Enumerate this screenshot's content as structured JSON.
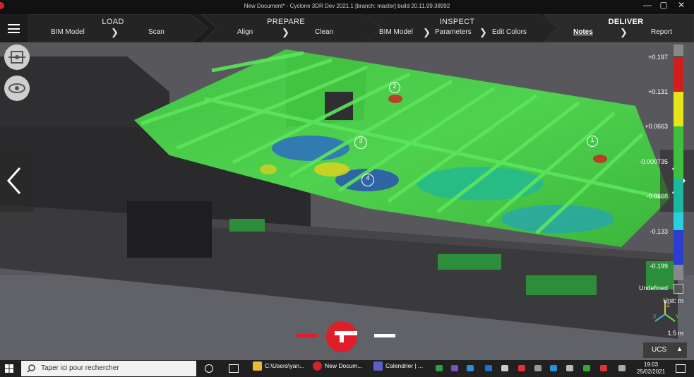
{
  "window": {
    "title": "New Document* - Cyclone 3DR Dev 2021.1 [branch: master] build 20.11.99.38992",
    "minimize": "—",
    "maximize": "▢",
    "close": "✕"
  },
  "ribbon": {
    "stages": [
      {
        "name": "LOAD",
        "steps": [
          "BIM Model",
          "Scan"
        ]
      },
      {
        "name": "PREPARE",
        "steps": [
          "Align",
          "Clean"
        ]
      },
      {
        "name": "INSPECT",
        "steps": [
          "BIM Model",
          "Parameters",
          "Edit Colors"
        ]
      },
      {
        "name": "DELIVER",
        "steps": [
          "Notes",
          "Report"
        ]
      }
    ],
    "chevron": "❯"
  },
  "viewport": {
    "markers": [
      "1",
      "2",
      "3",
      "4"
    ]
  },
  "legend": {
    "labels": [
      "+0.197",
      "+0.131",
      "+0.0663",
      "-0.000735",
      "-0.0668",
      "-0.133",
      "-0.199"
    ],
    "undefined_label": "Undefined",
    "unit": "Unit: m",
    "scale": "1.5 m",
    "axes": [
      "Z",
      "X",
      "Y"
    ],
    "colors": [
      "#d31e1e",
      "#e5e51a",
      "#3fbf3f",
      "#1bb7a0",
      "#2bd0e0",
      "#2a3fcf",
      "#8a8a8a"
    ]
  },
  "ucs": {
    "label": "UCS",
    "arrow": "▲"
  },
  "taskbar": {
    "search_placeholder": "Taper ici pour rechercher",
    "apps": [
      "C:\\Users\\yan...",
      "New Docum...",
      "Calendrier | ..."
    ],
    "time": "19:03",
    "date": "25/02/2021"
  }
}
